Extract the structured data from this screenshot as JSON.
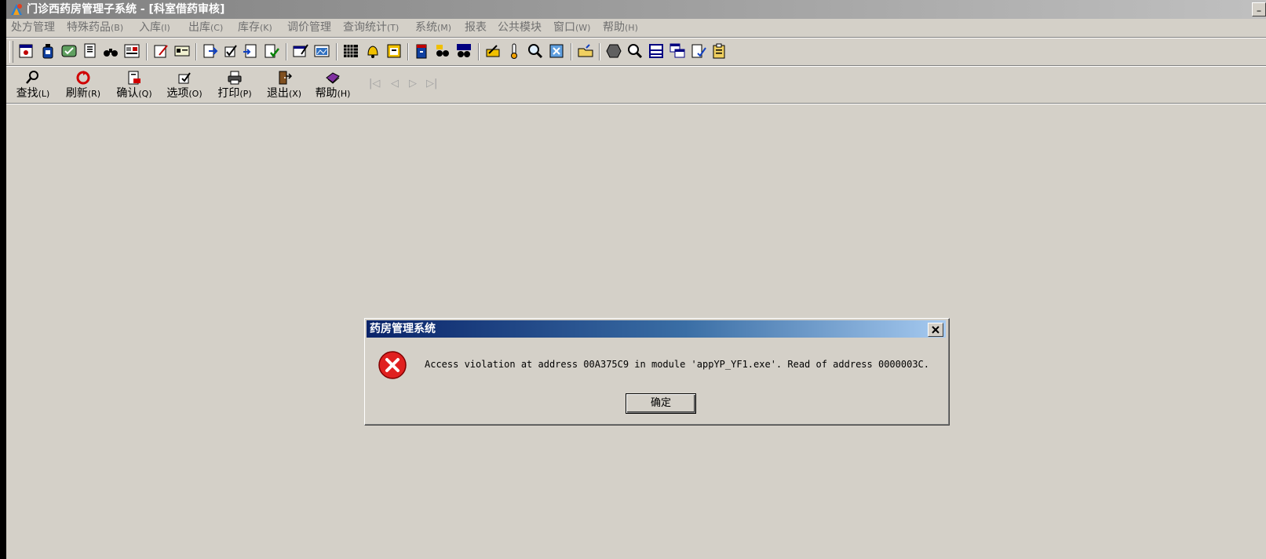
{
  "window": {
    "title": "门诊西药房管理子系统 - [科室借药审核]",
    "minimize_glyph": "_"
  },
  "menu": [
    {
      "label": "处方管理",
      "acc": ""
    },
    {
      "label": "特殊药品",
      "acc": "(B)"
    },
    {
      "label": "入库",
      "acc": "(I)"
    },
    {
      "label": "出库",
      "acc": "(C)"
    },
    {
      "label": "库存",
      "acc": "(K)"
    },
    {
      "label": "调价管理",
      "acc": ""
    },
    {
      "label": "查询统计",
      "acc": "(T)"
    },
    {
      "label": "系统",
      "acc": "(M)"
    },
    {
      "label": "报表",
      "acc": ""
    },
    {
      "label": "公共模块",
      "acc": ""
    },
    {
      "label": "窗口",
      "acc": "(W)"
    },
    {
      "label": "帮助",
      "acc": "(H)"
    }
  ],
  "form_toolbar": [
    {
      "label": "查找",
      "acc": "(L)"
    },
    {
      "label": "刷新",
      "acc": "(R)"
    },
    {
      "label": "确认",
      "acc": "(Q)"
    },
    {
      "label": "选项",
      "acc": "(O)"
    },
    {
      "label": "打印",
      "acc": "(P)"
    },
    {
      "label": "退出",
      "acc": "(X)"
    },
    {
      "label": "帮助",
      "acc": "(H)"
    }
  ],
  "nav_arrows": [
    "|◁",
    "◁",
    "▷",
    "▷|"
  ],
  "dialog": {
    "title": "药房管理系统",
    "message": "Access violation at address 00A375C9 in module 'appYP_YF1.exe'. Read of address 0000003C.",
    "ok_label": "确定",
    "close_glyph": "×"
  },
  "colors": {
    "window_bg": "#d4d0c8",
    "dialog_title_start": "#0a246a",
    "dialog_title_end": "#a6caf0",
    "error_icon": "#e02020"
  }
}
